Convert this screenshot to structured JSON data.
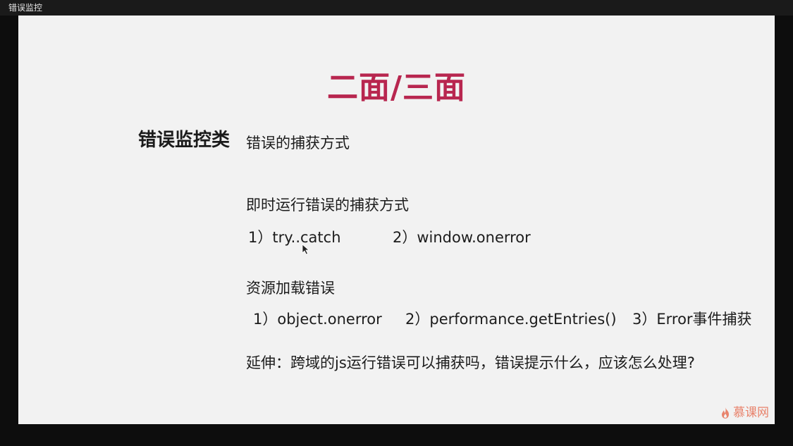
{
  "window": {
    "title": "错误监控"
  },
  "slide": {
    "title": "二面/三面",
    "category": "错误监控类",
    "heading": "错误的捕获方式",
    "runtime": {
      "heading": "即时运行错误的捕获方式",
      "item1": "1）try..catch",
      "item2": "2）window.onerror"
    },
    "resource": {
      "heading": "资源加载错误",
      "item1": "1）object.onerror",
      "item2": "2）performance.getEntries()",
      "item3": "3）Error事件捕获"
    },
    "extension": "延伸：跨域的js运行错误可以捕获吗，错误提示什么，应该怎么处理?"
  },
  "brand": {
    "text": "慕课网",
    "icon": "flame-logo-icon",
    "color": "#e8836c"
  },
  "colors": {
    "title": "#b8264f",
    "slide_bg": "#f2f2f2",
    "frame": "#0d0d0d"
  }
}
